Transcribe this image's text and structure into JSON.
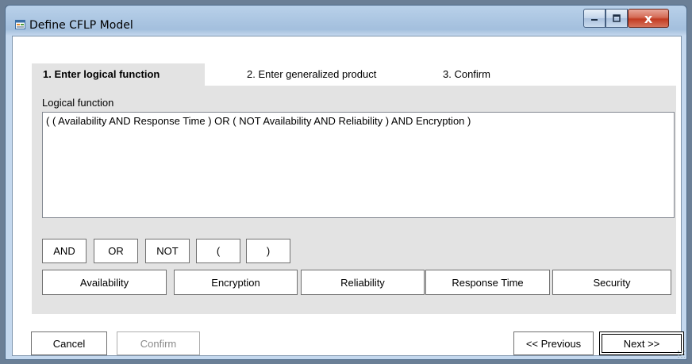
{
  "window": {
    "title": "Define CFLP Model",
    "app_icon": "form-icon",
    "minimize_icon": "minimize-icon",
    "maximize_icon": "maximize-icon",
    "close_icon": "close-icon",
    "close_glyph": "x"
  },
  "tabs": [
    {
      "label": "1. Enter logical function",
      "active": true
    },
    {
      "label": "2. Enter generalized product",
      "active": false
    },
    {
      "label": "3. Confirm",
      "active": false
    }
  ],
  "logical_function": {
    "label": "Logical function",
    "value": "( ( Availability AND Response Time ) OR ( NOT Availability AND Reliability ) AND Encryption )"
  },
  "operators": [
    "AND",
    "OR",
    "NOT",
    "(",
    ")"
  ],
  "attributes": [
    "Availability",
    "Encryption",
    "Reliability",
    "Response Time",
    "Security"
  ],
  "footer": {
    "cancel": "Cancel",
    "confirm": "Confirm",
    "previous": "<< Previous",
    "next": "Next >>"
  },
  "colors": {
    "titlebar": "#b9d1ea",
    "panel": "#e3e3e3",
    "close_button": "#c23b22"
  }
}
